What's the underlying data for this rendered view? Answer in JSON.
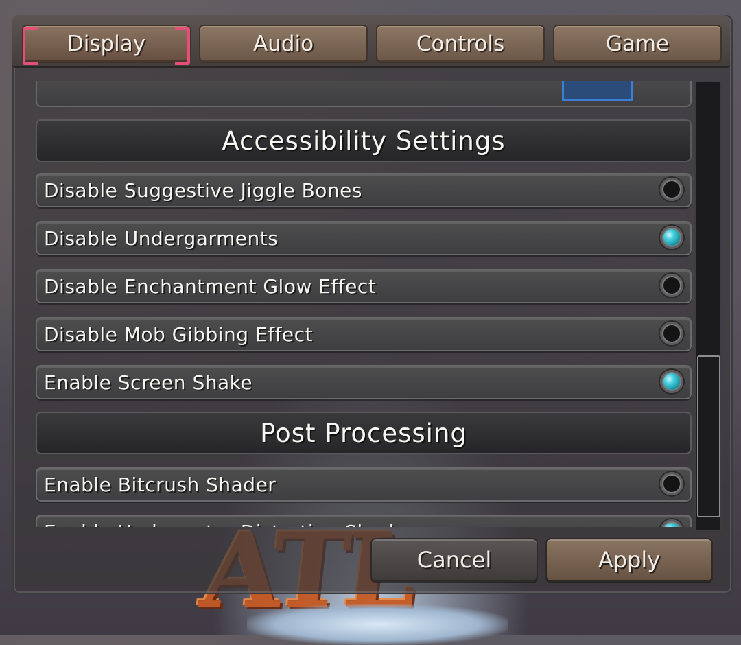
{
  "tabs": [
    {
      "label": "Display",
      "active": true
    },
    {
      "label": "Audio",
      "active": false
    },
    {
      "label": "Controls",
      "active": false
    },
    {
      "label": "Game",
      "active": false
    }
  ],
  "sections": {
    "accessibility": {
      "title": "Accessibility Settings",
      "items": [
        {
          "label": "Disable Suggestive Jiggle Bones",
          "enabled": false
        },
        {
          "label": "Disable Undergarments",
          "enabled": true
        },
        {
          "label": "Disable Enchantment Glow Effect",
          "enabled": false
        },
        {
          "label": "Disable Mob Gibbing Effect",
          "enabled": false
        },
        {
          "label": "Enable Screen Shake",
          "enabled": true
        }
      ]
    },
    "post_processing": {
      "title": "Post Processing",
      "items": [
        {
          "label": "Enable Bitcrush Shader",
          "enabled": false
        },
        {
          "label": "Enable Underwater Distortion Shader",
          "enabled": true
        }
      ]
    }
  },
  "footer": {
    "cancel_label": "Cancel",
    "apply_label": "Apply"
  },
  "background": {
    "logo_text": "ATLYSS"
  },
  "colors": {
    "active_tab_bracket": "#e34f77",
    "toggle_on": "#4bd0de",
    "tab_wood": "#7a6453"
  }
}
